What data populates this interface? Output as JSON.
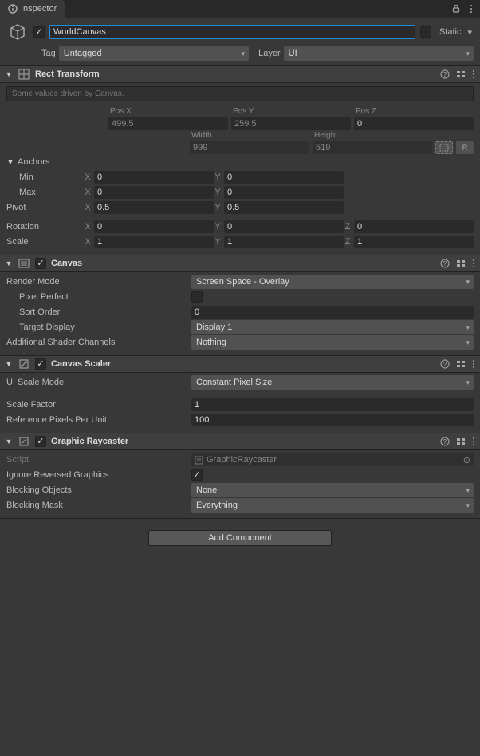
{
  "tab": {
    "title": "Inspector"
  },
  "header": {
    "active": true,
    "name": "WorldCanvas",
    "static_label": "Static",
    "tag_label": "Tag",
    "tag_value": "Untagged",
    "layer_label": "Layer",
    "layer_value": "UI"
  },
  "rect_transform": {
    "title": "Rect Transform",
    "driven_note": "Some values driven by Canvas.",
    "pos_x_label": "Pos X",
    "pos_x": "499.5",
    "pos_y_label": "Pos Y",
    "pos_y": "259.5",
    "pos_z_label": "Pos Z",
    "pos_z": "0",
    "width_label": "Width",
    "width": "999",
    "height_label": "Height",
    "height": "519",
    "anchors_label": "Anchors",
    "min_label": "Min",
    "min_x": "0",
    "min_y": "0",
    "max_label": "Max",
    "max_x": "0",
    "max_y": "0",
    "pivot_label": "Pivot",
    "pivot_x": "0.5",
    "pivot_y": "0.5",
    "rotation_label": "Rotation",
    "rot_x": "0",
    "rot_y": "0",
    "rot_z": "0",
    "scale_label": "Scale",
    "scale_x": "1",
    "scale_y": "1",
    "scale_z": "1",
    "r_label": "R"
  },
  "canvas": {
    "title": "Canvas",
    "render_mode_label": "Render Mode",
    "render_mode": "Screen Space - Overlay",
    "pixel_perfect_label": "Pixel Perfect",
    "pixel_perfect": false,
    "sort_order_label": "Sort Order",
    "sort_order": "0",
    "target_display_label": "Target Display",
    "target_display": "Display 1",
    "shader_channels_label": "Additional Shader Channels",
    "shader_channels": "Nothing"
  },
  "canvas_scaler": {
    "title": "Canvas Scaler",
    "ui_scale_mode_label": "UI Scale Mode",
    "ui_scale_mode": "Constant Pixel Size",
    "scale_factor_label": "Scale Factor",
    "scale_factor": "1",
    "ref_px_label": "Reference Pixels Per Unit",
    "ref_px": "100"
  },
  "raycaster": {
    "title": "Graphic Raycaster",
    "script_label": "Script",
    "script": "GraphicRaycaster",
    "ignore_reversed_label": "Ignore Reversed Graphics",
    "ignore_reversed": true,
    "blocking_objects_label": "Blocking Objects",
    "blocking_objects": "None",
    "blocking_mask_label": "Blocking Mask",
    "blocking_mask": "Everything"
  },
  "add_component": "Add Component"
}
